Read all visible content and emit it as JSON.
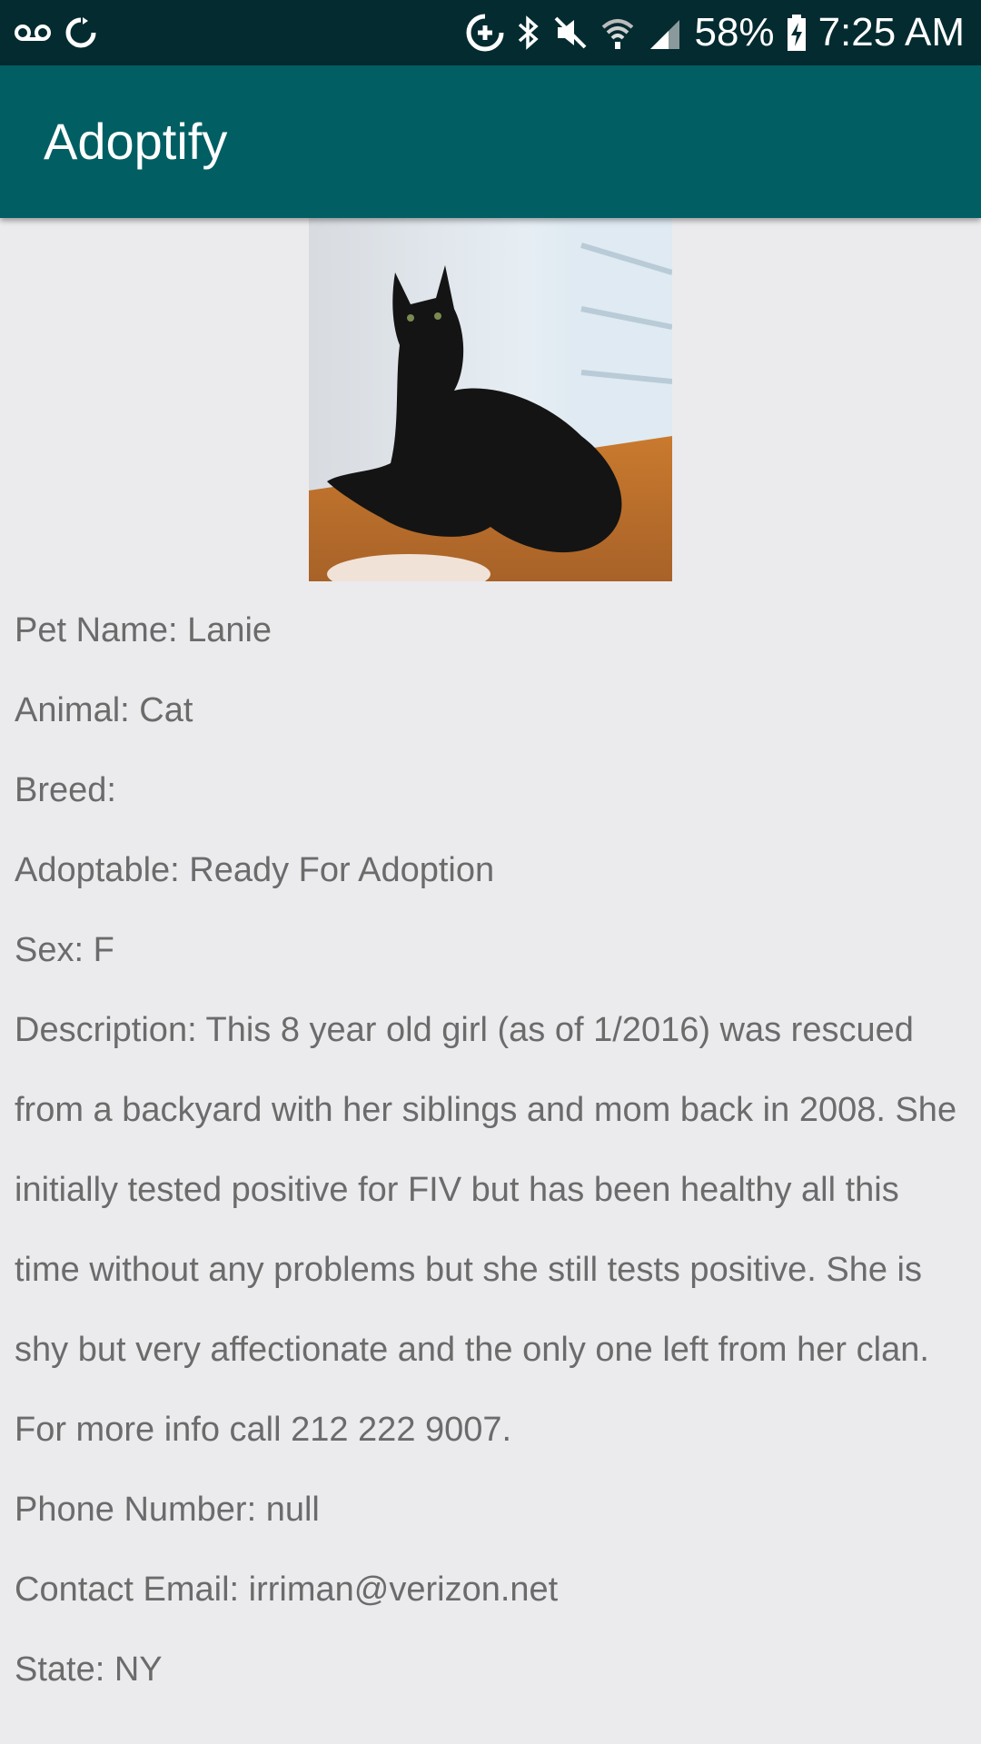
{
  "status_bar": {
    "battery": "58%",
    "time": "7:25 AM",
    "icons": [
      "voicemail-icon",
      "sync-icon",
      "data-saver-icon",
      "bluetooth-icon",
      "mute-icon",
      "wifi-icon",
      "signal-icon",
      "battery-charging-icon"
    ]
  },
  "app_bar": {
    "title": "Adoptify"
  },
  "pet": {
    "photo": "black-cat-photo",
    "name": "Pet Name: Lanie",
    "animal": "Animal: Cat",
    "breed": "Breed:",
    "adoptable": "Adoptable: Ready For Adoption",
    "sex": "Sex: F",
    "description": "Description: This 8 year old girl (as of 1/2016) was rescued from a backyard with her siblings and mom back in 2008.  She initially tested positive for FIV but has been healthy all this time without any problems but she still tests positive.  She is shy but very affectionate and the only one left from her clan.  For more info call 212 222 9007.",
    "phone": "Phone Number: null",
    "email": "Contact Email: irriman@verizon.net",
    "state": "State: NY"
  },
  "colors": {
    "status_bar": "#032b30",
    "app_bar": "#015f63",
    "background": "#ebebee",
    "text": "#6b6b6b"
  }
}
